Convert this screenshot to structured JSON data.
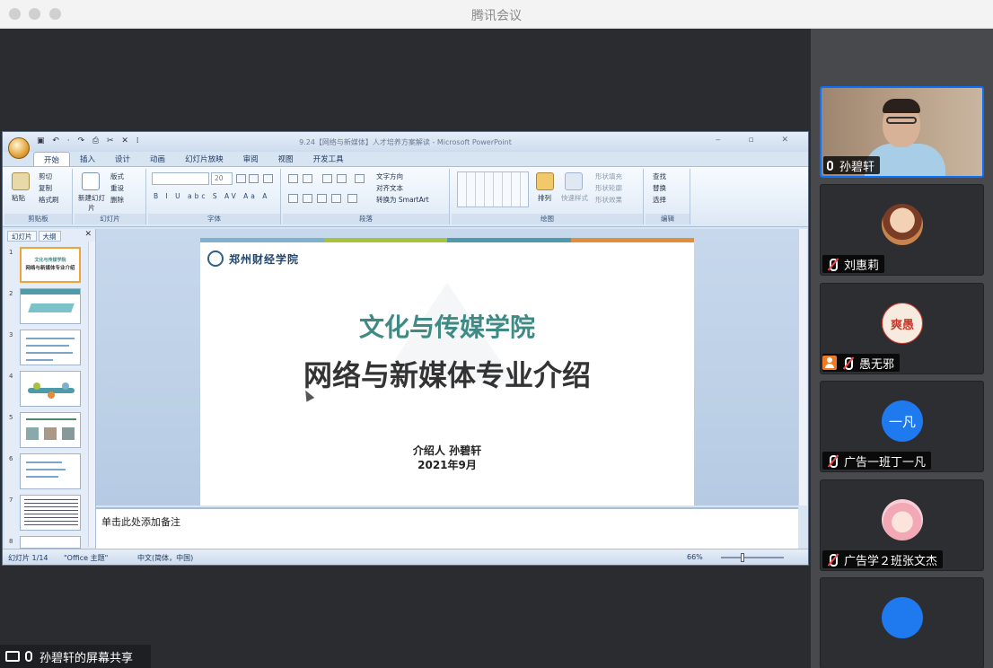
{
  "app": {
    "title": "腾讯会议"
  },
  "share": {
    "label": "孙碧轩的屏幕共享"
  },
  "ppt": {
    "title": "9.24【网络与新媒体】人才培养方案解读 - Microsoft PowerPoint",
    "quick_access": "▣ ↶ · ↷ ⎙ ✂ ✕ ⁞",
    "window_controls": "‒ ▫ ✕",
    "tabs": [
      "开始",
      "插入",
      "设计",
      "动画",
      "幻灯片放映",
      "审阅",
      "视图",
      "开发工具"
    ],
    "active_tab": "开始",
    "ribbon": {
      "clipboard": {
        "label": "剪贴板",
        "paste": "粘贴",
        "cut": "剪切",
        "copy": "复制",
        "format_painter": "格式刷"
      },
      "slides": {
        "label": "幻灯片",
        "new_slide": "新建幻灯片",
        "layout": "版式",
        "reset": "重设",
        "delete": "删除"
      },
      "font": {
        "label": "字体",
        "size": "20",
        "buttons": "B I U abc S AV Aa A"
      },
      "paragraph": {
        "label": "段落",
        "text_direction": "文字方向",
        "align_text": "对齐文本",
        "smartart": "转换为 SmartArt"
      },
      "drawing": {
        "label": "绘图",
        "arrange": "排列",
        "quick_styles": "快速样式",
        "shape_fill": "形状填充",
        "shape_outline": "形状轮廓",
        "shape_effects": "形状效果"
      },
      "editing": {
        "label": "编辑",
        "find": "查找",
        "replace": "替换",
        "select": "选择"
      }
    },
    "panel": {
      "tab_slides": "幻灯片",
      "tab_outline": "大纲",
      "close": "✕",
      "thumb_numbers": [
        "1",
        "2",
        "3",
        "4",
        "5",
        "6",
        "7",
        "8"
      ],
      "slide1_line1": "文化与传媒学院",
      "slide1_line2": "网络与新媒体专业介绍"
    },
    "slide": {
      "logo_text": "郑州财经学院",
      "title1": "文化与传媒学院",
      "title2": "网络与新媒体专业介绍",
      "presenter": "介绍人   孙碧轩",
      "date": "2021年9月",
      "stripe_colors": [
        "#7fb0c9",
        "#a8c23e",
        "#4f9aa8",
        "#e08e3c"
      ]
    },
    "notes_placeholder": "单击此处添加备注",
    "status": {
      "slide_count": "幻灯片 1/14",
      "theme": "\"Office 主题\"",
      "language": "中文(简体，中国)",
      "zoom": "66%"
    }
  },
  "participants": [
    {
      "name": "孙碧轩",
      "mic": "on",
      "video": true,
      "speaking": true
    },
    {
      "name": "刘惠莉",
      "mic": "off",
      "avatar": "cartoon"
    },
    {
      "name": "愚无邪",
      "mic": "off",
      "avatar": "seal",
      "host": true,
      "avatar_text": "爽愚"
    },
    {
      "name": "广告一班丁一凡",
      "mic": "off",
      "avatar": "initials",
      "avatar_text": "一凡",
      "avatar_color": "#1f7af0"
    },
    {
      "name": "广告学２班张文杰",
      "mic": "off",
      "avatar": "anime"
    },
    {
      "name": "",
      "mic": "off",
      "avatar": "initials",
      "avatar_color": "#1f7af0"
    }
  ]
}
